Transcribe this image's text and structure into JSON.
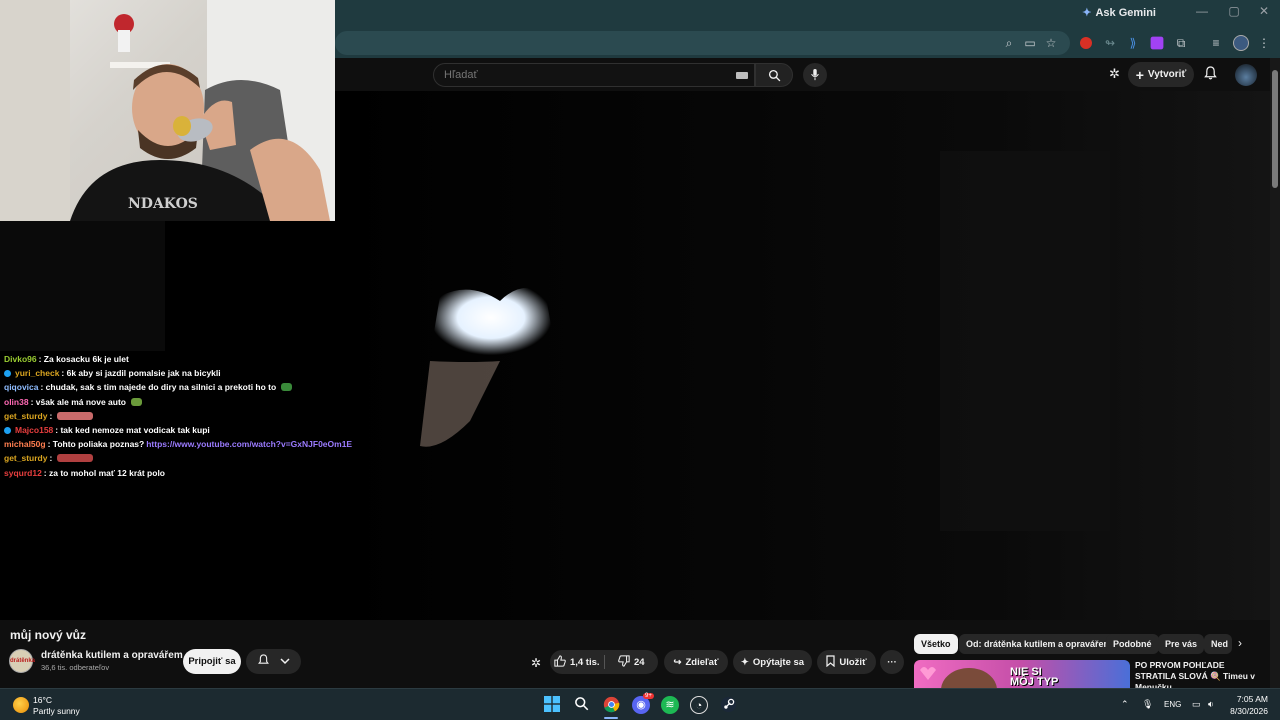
{
  "browser": {
    "ask_gemini": "Ask Gemini"
  },
  "youtube": {
    "search_placeholder": "Hľadať",
    "create_label": "Vytvoriť"
  },
  "webcam": {
    "shirt_text": "NDAKOS"
  },
  "chat": {
    "messages": [
      {
        "user": "Divko96",
        "user_color": "#9acd32",
        "text": ": Za kosacku 6k je ulet",
        "badge": false,
        "emote": "",
        "link": ""
      },
      {
        "user": "yuri_check",
        "user_color": "#daa520",
        "text": ": 6k aby si jazdil pomalsie jak na bicykli",
        "badge": true,
        "emote": "",
        "link": ""
      },
      {
        "user": "qiqovica",
        "user_color": "#8fbcff",
        "text": ": chudak, sak s tim najede do diry na silnici a prekoti ho to",
        "badge": false,
        "emote": "#3a8a3a",
        "link": ""
      },
      {
        "user": "olin38",
        "user_color": "#ff69b4",
        "text": ": však ale má nove auto",
        "badge": false,
        "emote": "#6a9a3a",
        "link": ""
      },
      {
        "user": "get_sturdy",
        "user_color": "#daa520",
        "text": ":",
        "badge": false,
        "emote": "#c86a6a",
        "link": ""
      },
      {
        "user": "Majco158",
        "user_color": "#e83e3e",
        "text": ": tak ked nemoze mat vodicak tak kupi",
        "badge": true,
        "emote": "",
        "link": ""
      },
      {
        "user": "michal50g",
        "user_color": "#ff7f50",
        "text": ": Tohto poliaka poznas?",
        "badge": false,
        "emote": "",
        "link": "https://www.youtube.com/watch?v=GxNJF0eOm1E"
      },
      {
        "user": "get_sturdy",
        "user_color": "#daa520",
        "text": ":",
        "badge": false,
        "emote": "#b04040",
        "link": ""
      },
      {
        "user": "syqurd12",
        "user_color": "#e83e3e",
        "text": ": za to mohol mať 12 krát polo",
        "badge": false,
        "emote": "",
        "link": ""
      }
    ]
  },
  "video": {
    "title": "můj nový vůz",
    "channel_name": "drátěnka kutilem a opravářem",
    "channel_subs": "36,6 tis. odberateľov",
    "channel_avatar_text": "drátěnka",
    "join_label": "Pripojiť sa",
    "like_count": "1,4 tis.",
    "dislike_count": "24",
    "share_label": "Zdieľať",
    "ask_label": "Opýtajte sa",
    "save_label": "Uložiť",
    "more_label": "···"
  },
  "related": {
    "chips": [
      {
        "label": "Všetko",
        "active": true
      },
      {
        "label": "Od: drátěnka kutilem a opravářem",
        "active": false
      },
      {
        "label": "Podobné",
        "active": false
      },
      {
        "label": "Pre vás",
        "active": false
      },
      {
        "label": "Ned",
        "active": false
      }
    ],
    "thumb_text_1": "NIE SI",
    "thumb_text_2": "MÔJ TYP",
    "video_title": "PO PRVOM POHĽADE STRATILA SLOVÁ 🍭 Timeu v Menučku"
  },
  "taskbar": {
    "weather_temp": "16°C",
    "weather_desc": "Partly sunny",
    "lang": "ENG",
    "time": "7:05 AM",
    "date": "8/30/2026",
    "discord_badge": "9+"
  },
  "colors": {
    "chrome_bg": "#1f3a3f",
    "yt_bg": "#0f0f0f",
    "pill_bg": "#272727",
    "link": "#9b7bff"
  }
}
